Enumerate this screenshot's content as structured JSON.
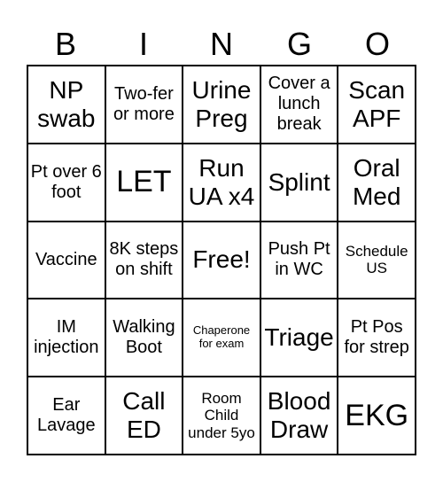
{
  "header": [
    "B",
    "I",
    "N",
    "G",
    "O"
  ],
  "cells": [
    "NP swab",
    "Two-fer or more",
    "Urine Preg",
    "Cover a lunch break",
    "Scan APF",
    "Pt over 6 foot",
    "LET",
    "Run UA x4",
    "Splint",
    "Oral Med",
    "Vaccine",
    "8K steps on shift",
    "Free!",
    "Push Pt in WC",
    "Schedule US",
    "IM injection",
    "Walking Boot",
    "Chaperone for exam",
    "Triage",
    "Pt Pos for strep",
    "Ear Lavage",
    "Call ED",
    "Room Child under 5yo",
    "Blood Draw",
    "EKG"
  ]
}
